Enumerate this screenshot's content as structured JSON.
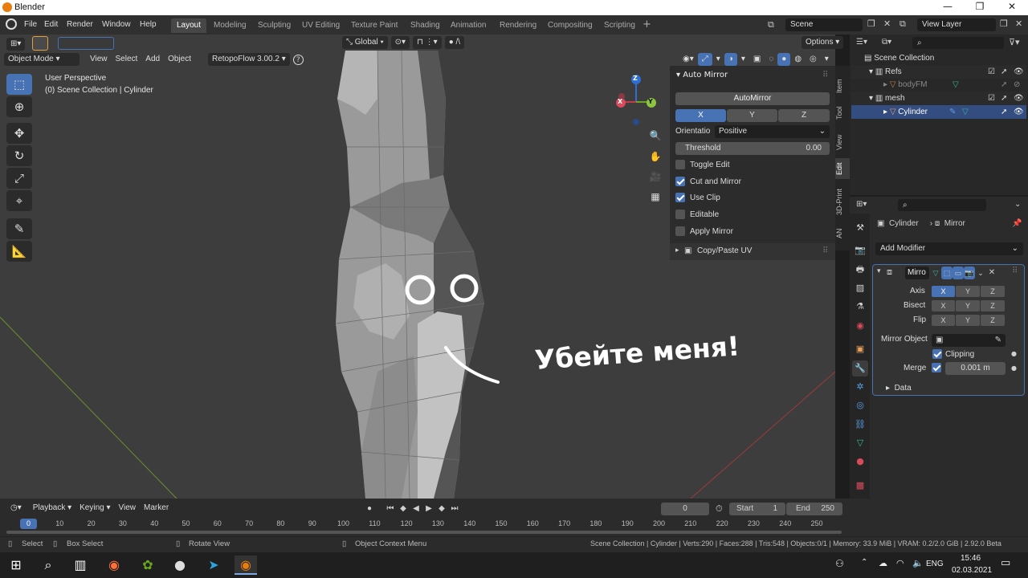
{
  "window": {
    "title": "Blender",
    "minimize": "—",
    "maximize": "❐",
    "close": "✕"
  },
  "menu": [
    "File",
    "Edit",
    "Render",
    "Window",
    "Help"
  ],
  "workspaces": [
    "Layout",
    "Modeling",
    "Sculpting",
    "UV Editing",
    "Texture Paint",
    "Shading",
    "Animation",
    "Rendering",
    "Compositing",
    "Scripting"
  ],
  "scene": {
    "name": "Scene",
    "view_layer": "View Layer"
  },
  "viewport_header": {
    "mode": "Object Mode",
    "menus": [
      "View",
      "Select",
      "Add",
      "Object"
    ],
    "addon": "RetopoFlow 3.00.2",
    "transform": "Global",
    "options": "Options"
  },
  "viewport_info": {
    "line1": "User Perspective",
    "line2": "(0) Scene Collection | Cylinder"
  },
  "annotation": {
    "text": "Убейте меня!"
  },
  "gizmo": {
    "x": "X",
    "y": "Y",
    "z": "Z"
  },
  "npanel": {
    "title": "Auto Mirror",
    "button": "AutoMirror",
    "axes": [
      "X",
      "Y",
      "Z"
    ],
    "orientation_label": "Orientatio",
    "orientation_value": "Positive",
    "threshold_label": "Threshold",
    "threshold_value": "0.00",
    "checks": [
      {
        "label": "Toggle Edit",
        "checked": false
      },
      {
        "label": "Cut and Mirror",
        "checked": true
      },
      {
        "label": "Use Clip",
        "checked": true
      },
      {
        "label": "Editable",
        "checked": false
      },
      {
        "label": "Apply Mirror",
        "checked": false
      }
    ],
    "copy_paste": "Copy/Paste UV",
    "tabs": [
      "Item",
      "Tool",
      "View",
      "Edit",
      "3D-Print",
      "AN"
    ]
  },
  "outliner": {
    "root": "Scene Collection",
    "items": [
      {
        "label": "Refs",
        "indent": 1,
        "kind": "collection"
      },
      {
        "label": "bodyFM",
        "indent": 2,
        "kind": "object-dim"
      },
      {
        "label": "mesh",
        "indent": 1,
        "kind": "collection"
      },
      {
        "label": "Cylinder",
        "indent": 2,
        "kind": "object-selected"
      }
    ]
  },
  "properties": {
    "object": "Cylinder",
    "modifier_context": "Mirror",
    "add_modifier": "Add Modifier",
    "modifier_name": "Mirro",
    "axis_label": "Axis",
    "bisect_label": "Bisect",
    "flip_label": "Flip",
    "axes": [
      "X",
      "Y",
      "Z"
    ],
    "mirror_object_label": "Mirror Object",
    "clipping_label": "Clipping",
    "merge_label": "Merge",
    "merge_value": "0.001 m",
    "data_label": "Data"
  },
  "timeline": {
    "menus": [
      "Playback",
      "Keying",
      "View",
      "Marker"
    ],
    "current_frame": "0",
    "start_label": "Start",
    "start_value": "1",
    "end_label": "End",
    "end_value": "250",
    "ticks": [
      "0",
      "10",
      "20",
      "30",
      "40",
      "50",
      "60",
      "70",
      "80",
      "90",
      "100",
      "110",
      "120",
      "130",
      "140",
      "150",
      "160",
      "170",
      "180",
      "190",
      "200",
      "210",
      "220",
      "230",
      "240",
      "250"
    ]
  },
  "statusbar": {
    "select": "Select",
    "box_select": "Box Select",
    "rotate_view": "Rotate View",
    "context_menu": "Object Context Menu",
    "stats": "Scene Collection | Cylinder | Verts:290 | Faces:288 | Tris:548 | Objects:0/1 | Memory: 33.9 MiB | VRAM: 0.2/2.0 GiB | 2.92.0 Beta"
  },
  "taskbar": {
    "lang": "ENG",
    "time": "15:46",
    "date": "02.03.2021"
  },
  "colors": {
    "accent": "#4772b3",
    "header": "#303030",
    "viewport": "#3d3d3d",
    "panel": "#2c2c2c"
  }
}
